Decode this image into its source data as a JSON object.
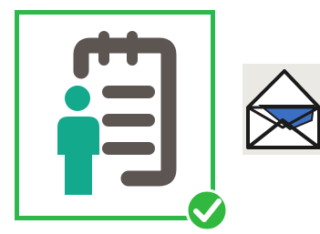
{
  "app": {
    "selected_item": "task-profile-tile",
    "selection_indicator": "checkmark-badge"
  },
  "tiles": [
    {
      "id": "task-profile-tile",
      "icon": "clipboard-user-icon",
      "selected": true
    },
    {
      "id": "mail-tile",
      "icon": "open-envelope-icon",
      "selected": false
    }
  ],
  "colors": {
    "selection_border": "#2db84c",
    "badge_fill": "#31b83e",
    "badge_check": "#ffffff",
    "clipboard_gray": "#5d5552",
    "user_teal": "#12a98c",
    "envelope_blue": "#3b6fc4",
    "envelope_bg": "#ebe9e3"
  }
}
